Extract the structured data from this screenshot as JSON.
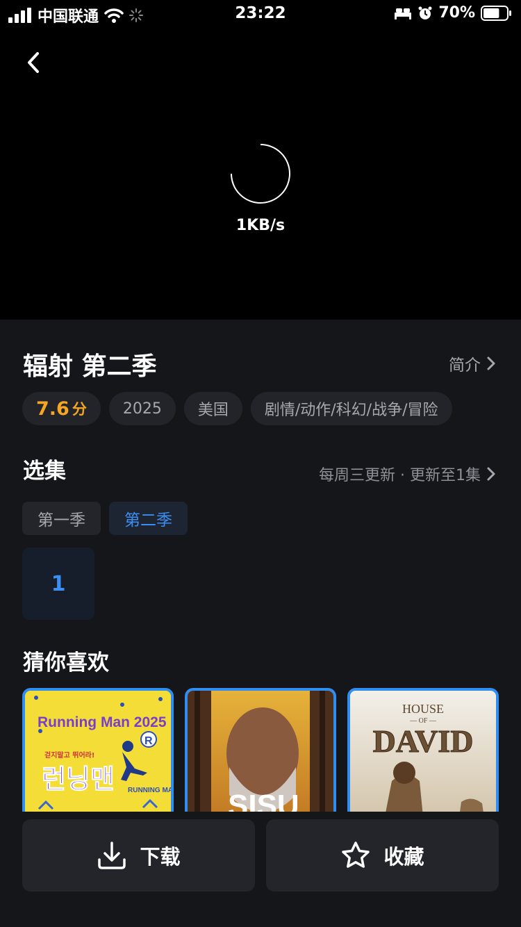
{
  "status_bar": {
    "carrier": "中国联通",
    "time": "23:22",
    "battery_percent": "70%",
    "battery_level": 0.7
  },
  "player": {
    "speed": "1KB/s"
  },
  "info": {
    "title": "辐射 第二季",
    "intro_label": "简介",
    "score": "7.6",
    "score_unit": "分",
    "year": "2025",
    "region": "美国",
    "genres": "剧情/动作/科幻/战争/冒险"
  },
  "episodes": {
    "section_title": "选集",
    "update_text": "每周三更新 · 更新至1集",
    "seasons": [
      "第一季",
      "第二季"
    ],
    "active_season": 1,
    "items": [
      "1"
    ]
  },
  "recommend": {
    "section_title": "猜你喜欢",
    "items": [
      {
        "title_line1": "Running Man 2025",
        "title_line2": "런닝맨",
        "tagline": "걷지말고 뛰어라!",
        "badge": "R",
        "logo": "RUNNING MAN"
      },
      {
        "title": "SISU"
      },
      {
        "title_top": "HOUSE",
        "title_mid": "— OF —",
        "title_main": "DAVID"
      }
    ]
  },
  "actions": {
    "download_label": "下载",
    "collect_label": "收藏"
  },
  "colors": {
    "accent": "#3d8ef2",
    "score": "#f5a623",
    "background": "#151619"
  }
}
